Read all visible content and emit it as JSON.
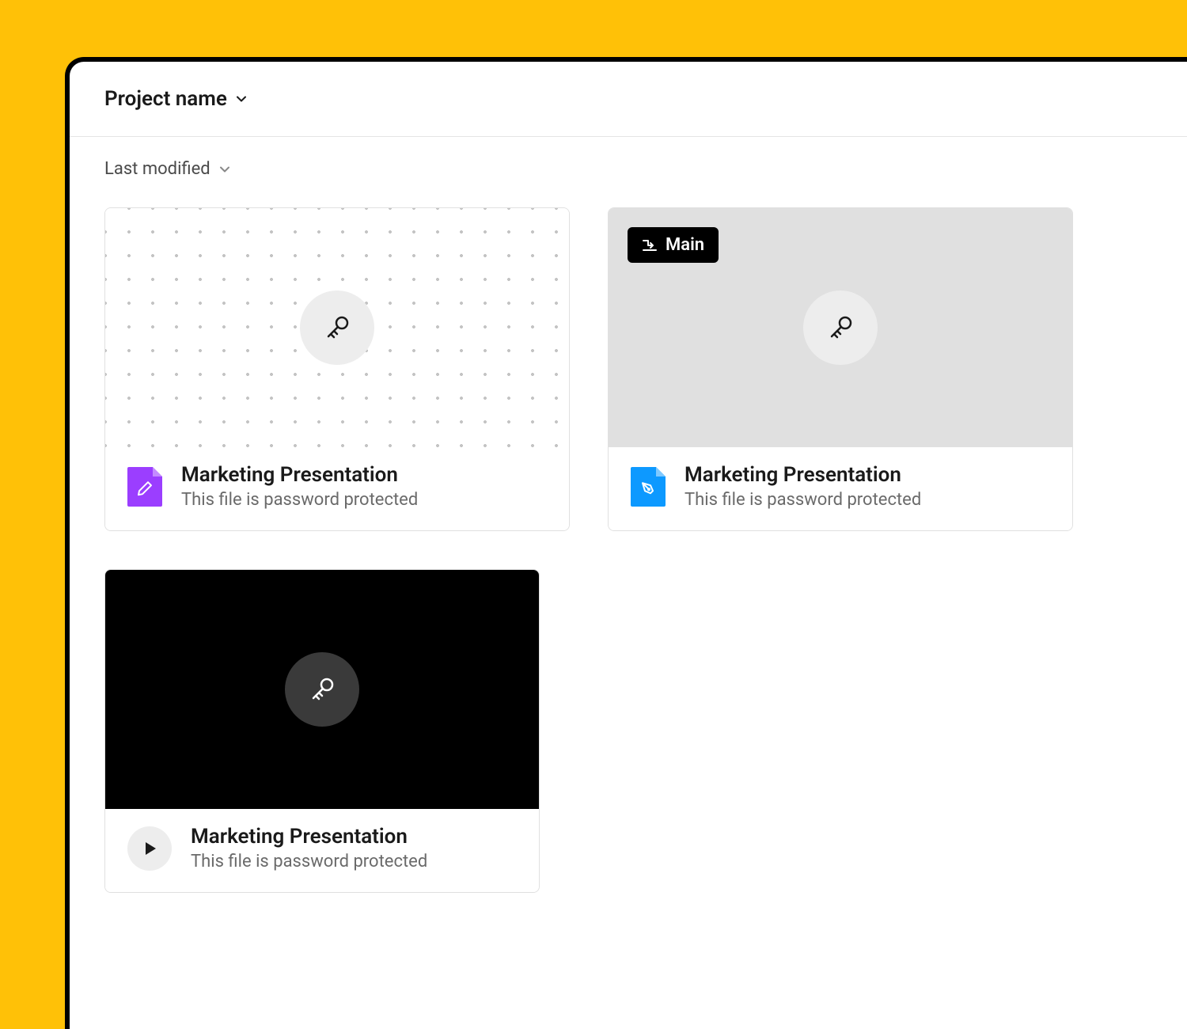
{
  "header": {
    "project_name": "Project name"
  },
  "sort": {
    "label": "Last modified"
  },
  "cards": [
    {
      "title": "Marketing Presentation",
      "subtitle": "This file is password protected",
      "icon_type": "pencil",
      "badge": null
    },
    {
      "title": "Marketing Presentation",
      "subtitle": "This file is password protected",
      "icon_type": "pen",
      "badge": "Main"
    },
    {
      "title": "Marketing Presentation",
      "subtitle": "This file is password protected",
      "icon_type": "play",
      "badge": null
    }
  ]
}
